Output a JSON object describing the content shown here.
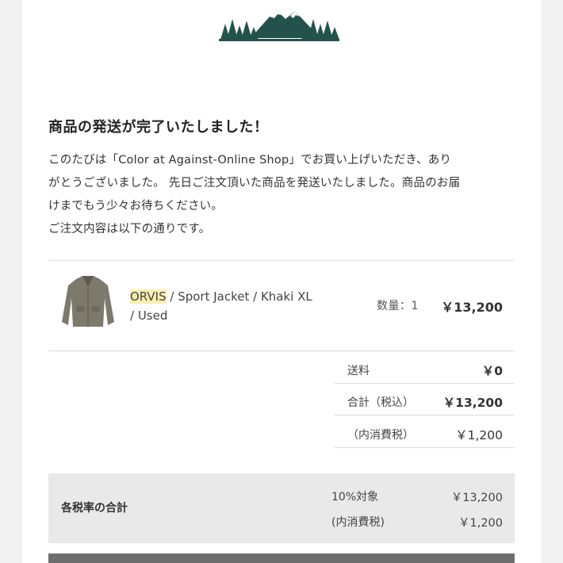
{
  "email": {
    "headline": "商品の発送が完了いたしました！",
    "intro_lines": [
      "このたびは「Color at Against-Online Shop」でお買い上げいただき、あり",
      "がとうございました。 先日ご注文頂いた商品を発送いたしました。商品のお届",
      "けまでもう少々お待ちください。",
      "ご注文内容は以下の通りです。"
    ]
  },
  "order": {
    "item": {
      "brand": "ORVIS",
      "title_line1_rest": " / Sport Jacket / Khaki XL",
      "title_line2": "/ Used",
      "quantity": "数量：1",
      "price": "￥13,200"
    },
    "summary": {
      "shipping_label": "送料",
      "shipping_value": "￥0",
      "total_label": "合計（税込）",
      "total_value": "￥13,200",
      "tax_label": "（内消費税）",
      "tax_value": "￥1,200"
    },
    "tax_rates": {
      "title": "各税率の合計",
      "rate_label": "10%対象",
      "rate_value": "￥13,200",
      "tax_label": "(内消費税)",
      "tax_value": "￥1,200"
    }
  },
  "colors": {
    "logo_green": "#23524d",
    "brand_highlight": "#fbefb0",
    "tax_box_bg": "#e9e9e9"
  },
  "icons": {
    "logo": "mountain-forest-logo",
    "product_image": "jacket-thumbnail"
  }
}
